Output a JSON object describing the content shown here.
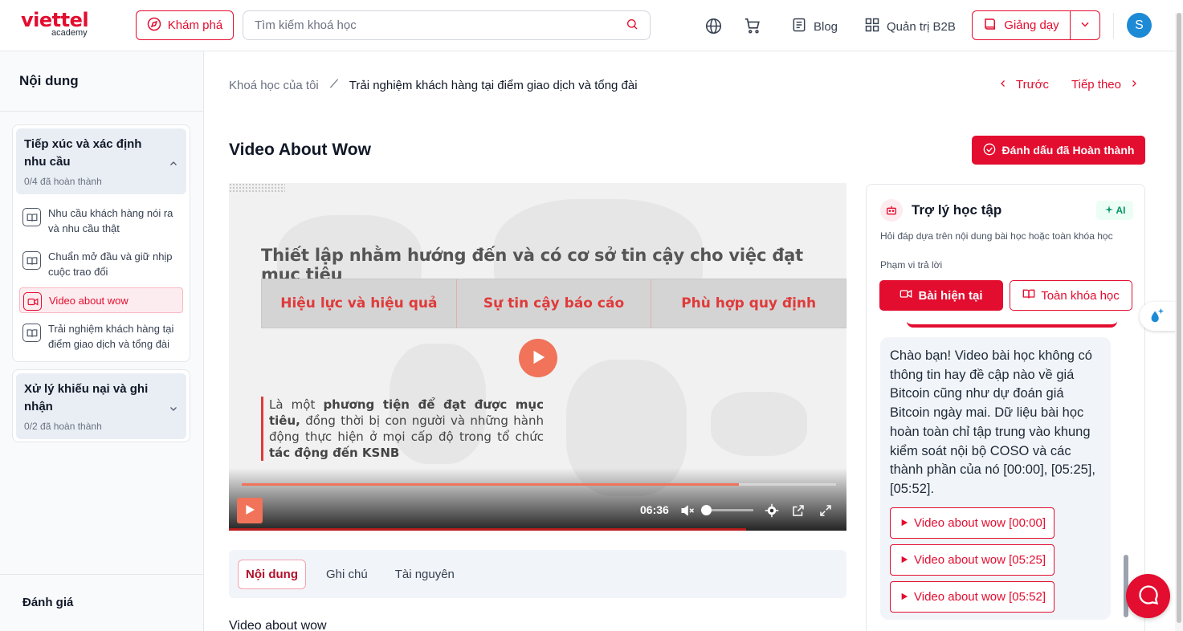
{
  "header": {
    "logo_brand": "viettel",
    "logo_sub": "academy",
    "explore_label": "Khám phá",
    "search_placeholder": "Tìm kiếm khoá học",
    "blog_label": "Blog",
    "b2b_label": "Quản trị B2B",
    "teach_label": "Giảng dạy",
    "avatar_initial": "S"
  },
  "sidebar": {
    "title": "Nội dung",
    "sections": [
      {
        "title": "Tiếp xúc và xác định nhu cầu",
        "progress": "0/4 đã hoàn thành",
        "expanded": true,
        "lessons": [
          {
            "label": "Nhu cầu khách hàng nói ra và nhu cầu thật",
            "icon": "book-icon",
            "active": false
          },
          {
            "label": "Chuẩn mở đầu và giữ nhịp cuộc trao đổi",
            "icon": "book-icon",
            "active": false
          },
          {
            "label": "Video about wow",
            "icon": "video-icon",
            "active": true
          },
          {
            "label": "Trải nghiệm khách hàng tại điểm giao dịch và tổng đài",
            "icon": "book-icon",
            "active": false
          }
        ]
      },
      {
        "title": "Xử lý khiếu nại và ghi nhận",
        "progress": "0/2 đã hoàn thành",
        "expanded": false
      }
    ],
    "evaluation_label": "Đánh giá"
  },
  "breadcrumb": {
    "parent": "Khoá học của tôi",
    "current": "Trải nghiệm khách hàng tại điểm giao dịch và tổng đài"
  },
  "nav": {
    "prev": "Trước",
    "next": "Tiếp theo"
  },
  "lesson": {
    "title": "Video About Wow",
    "mark_complete": "Đánh dấu đã Hoàn thành"
  },
  "video": {
    "slide_title": "Thiết lập nhằm hướng đến và có cơ sở tin cậy cho việc đạt mục tiêu",
    "columns": [
      "Hiệu lực và hiệu quả",
      "Sự tin cậy báo cáo",
      "Phù hợp quy định"
    ],
    "quote_1": "Là một ",
    "quote_2": "phương tiện để đạt được mục tiêu,",
    "quote_3": " đồng thời bị con người và những hành động thực hiện ở mọi cấp độ trong tổ chức ",
    "quote_4": "tác động đến KSNB",
    "time": "06:36",
    "progress_fraction": 0.837,
    "volume_fraction": 0.0
  },
  "tabs": [
    "Nội dung",
    "Ghi chú",
    "Tài nguyên"
  ],
  "content_heading": "Video about wow",
  "assistant": {
    "title": "Trợ lý học tập",
    "ai_badge": "AI",
    "subtitle": "Hỏi đáp dựa trên nội dung bài học hoặc toàn khóa học",
    "scope_label": "Phạm vi trả lời",
    "scope_current": "Bài hiện tại",
    "scope_all": "Toàn khóa học",
    "message": "Chào bạn! Video bài học không có thông tin hay đề cập nào về giá Bitcoin cũng như dự đoán giá Bitcoin ngày mai. Dữ liệu bài học hoàn toàn chỉ tập trung vào khung kiểm soát nội bộ COSO và các thành phần của nó [00:00], [05:25], [05:52].",
    "timestamps": [
      "Video about wow [00:00]",
      "Video about wow [05:25]",
      "Video about wow [05:52]"
    ]
  },
  "colors": {
    "brand": "#e30d2f",
    "video_accent": "#f0735a"
  }
}
